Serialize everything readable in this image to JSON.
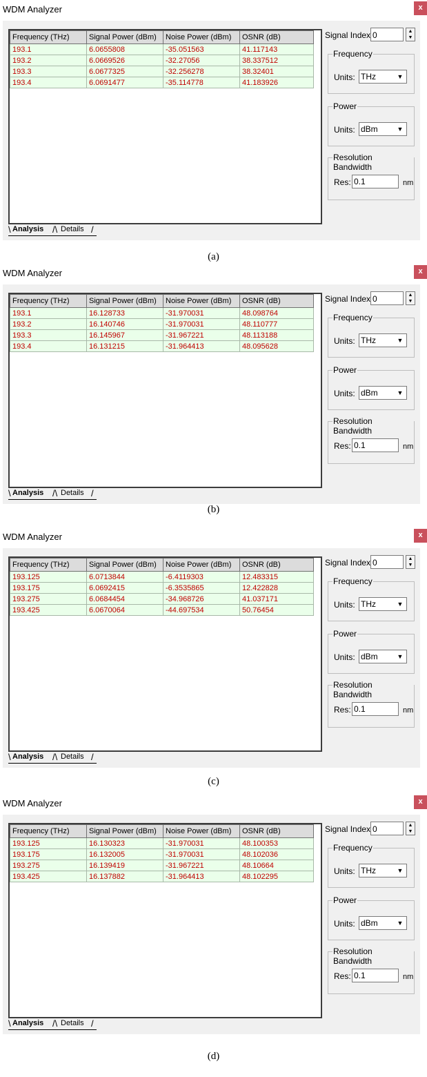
{
  "panels": [
    {
      "title": "WDM Analyzer",
      "close": "x",
      "columns": [
        "Frequency (THz)",
        "Signal Power (dBm)",
        "Noise Power (dBm)",
        "OSNR (dB)"
      ],
      "rows": [
        [
          "193.1",
          "6.0655808",
          "-35.051563",
          "41.117143"
        ],
        [
          "193.2",
          "6.0669526",
          "-32.27056",
          "38.337512"
        ],
        [
          "193.3",
          "6.0677325",
          "-32.256278",
          "38.32401"
        ],
        [
          "193.4",
          "6.0691477",
          "-35.114778",
          "41.183926"
        ]
      ],
      "tabs": [
        "Analysis",
        "Details"
      ],
      "signal_index_label": "Signal Index:",
      "signal_index_value": "0",
      "frequency_group": "Frequency",
      "frequency_units_label": "Units:",
      "frequency_units_value": "THz",
      "power_group": "Power",
      "power_units_label": "Units:",
      "power_units_value": "dBm",
      "resolution_group": "Resolution Bandwidth",
      "res_label": "Res:",
      "res_value": "0.1",
      "res_unit": "nm",
      "caption": "(a)"
    },
    {
      "title": "WDM Analyzer",
      "close": "x",
      "columns": [
        "Frequency (THz)",
        "Signal Power (dBm)",
        "Noise Power (dBm)",
        "OSNR (dB)"
      ],
      "rows": [
        [
          "193.1",
          "16.128733",
          "-31.970031",
          "48.098764"
        ],
        [
          "193.2",
          "16.140746",
          "-31.970031",
          "48.110777"
        ],
        [
          "193.3",
          "16.145967",
          "-31.967221",
          "48.113188"
        ],
        [
          "193.4",
          "16.131215",
          "-31.964413",
          "48.095628"
        ]
      ],
      "tabs": [
        "Analysis",
        "Details"
      ],
      "signal_index_label": "Signal Index:",
      "signal_index_value": "0",
      "frequency_group": "Frequency",
      "frequency_units_label": "Units:",
      "frequency_units_value": "THz",
      "power_group": "Power",
      "power_units_label": "Units:",
      "power_units_value": "dBm",
      "resolution_group": "Resolution Bandwidth",
      "res_label": "Res:",
      "res_value": "0.1",
      "res_unit": "nm",
      "caption": "(b)"
    },
    {
      "title": "WDM Analyzer",
      "close": "x",
      "columns": [
        "Frequency (THz)",
        "Signal Power (dBm)",
        "Noise Power (dBm)",
        "OSNR (dB)"
      ],
      "rows": [
        [
          "193.125",
          "6.0713844",
          "-6.4119303",
          "12.483315"
        ],
        [
          "193.175",
          "6.0692415",
          "-6.3535865",
          "12.422828"
        ],
        [
          "193.275",
          "6.0684454",
          "-34.968726",
          "41.037171"
        ],
        [
          "193.425",
          "6.0670064",
          "-44.697534",
          "50.76454"
        ]
      ],
      "tabs": [
        "Analysis",
        "Details"
      ],
      "signal_index_label": "Signal Index:",
      "signal_index_value": "0",
      "frequency_group": "Frequency",
      "frequency_units_label": "Units:",
      "frequency_units_value": "THz",
      "power_group": "Power",
      "power_units_label": "Units:",
      "power_units_value": "dBm",
      "resolution_group": "Resolution Bandwidth",
      "res_label": "Res:",
      "res_value": "0.1",
      "res_unit": "nm",
      "caption": "(c)"
    },
    {
      "title": "WDM Analyzer",
      "close": "x",
      "columns": [
        "Frequency (THz)",
        "Signal Power (dBm)",
        "Noise Power (dBm)",
        "OSNR (dB)"
      ],
      "rows": [
        [
          "193.125",
          "16.130323",
          "-31.970031",
          "48.100353"
        ],
        [
          "193.175",
          "16.132005",
          "-31.970031",
          "48.102036"
        ],
        [
          "193.275",
          "16.139419",
          "-31.967221",
          "48.10664"
        ],
        [
          "193.425",
          "16.137882",
          "-31.964413",
          "48.102295"
        ]
      ],
      "tabs": [
        "Analysis",
        "Details"
      ],
      "signal_index_label": "Signal Index:",
      "signal_index_value": "0",
      "frequency_group": "Frequency",
      "frequency_units_label": "Units:",
      "frequency_units_value": "THz",
      "power_group": "Power",
      "power_units_label": "Units:",
      "power_units_value": "dBm",
      "resolution_group": "Resolution Bandwidth",
      "res_label": "Res:",
      "res_value": "0.1",
      "res_unit": "nm",
      "caption": "(d)"
    }
  ],
  "colors": {
    "close_button": "#c9505c",
    "cell_background": "#eaffea",
    "cell_text": "#c00000",
    "window_background": "#f0f0f0"
  },
  "icons": {
    "close": "close-icon",
    "spinner": "spinner-icon",
    "dropdown": "chevron-down-icon"
  }
}
